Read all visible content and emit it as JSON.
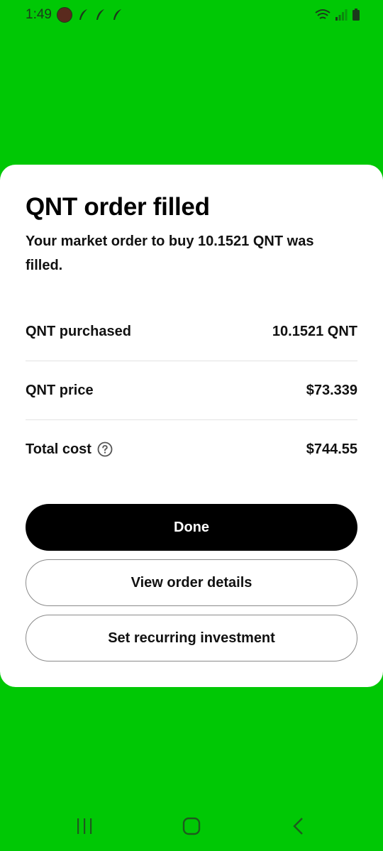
{
  "status_bar": {
    "time": "1:49"
  },
  "card": {
    "title": "QNT order filled",
    "subtitle": "Your market order to buy 10.1521 QNT was filled.",
    "rows": [
      {
        "label": "QNT purchased",
        "value": "10.1521 QNT"
      },
      {
        "label": "QNT price",
        "value": "$73.339"
      },
      {
        "label": "Total cost",
        "value": "$744.55"
      }
    ],
    "buttons": {
      "done": "Done",
      "view_details": "View order details",
      "recurring": "Set recurring investment"
    }
  },
  "colors": {
    "background": "#00c805",
    "card": "#ffffff",
    "primary_button": "#000000"
  },
  "icons": {
    "help": "question-circle-icon",
    "recents": "recent-apps-icon",
    "home": "home-icon",
    "back": "back-icon"
  }
}
